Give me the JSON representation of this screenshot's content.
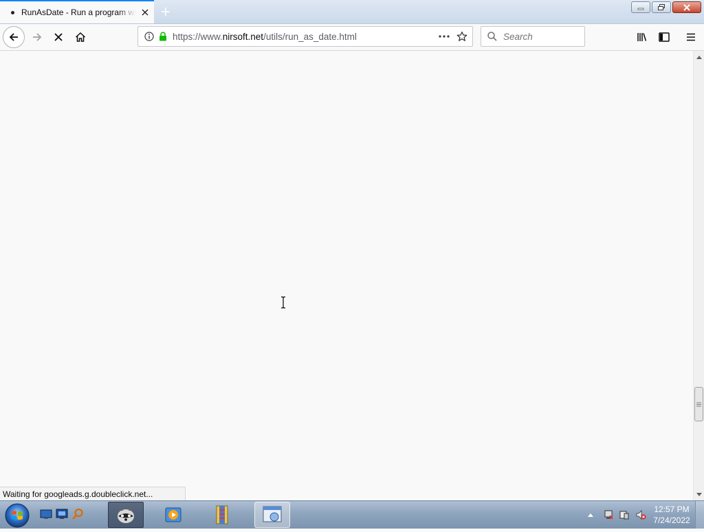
{
  "browser": {
    "tab": {
      "title": "RunAsDate - Run a program with the date/time that you specify"
    },
    "url": {
      "prefix": "https://www.",
      "domain": "nirsoft.net",
      "path": "/utils/run_as_date.html"
    },
    "search": {
      "placeholder": "Search"
    },
    "status": "Waiting for googleads.g.doubleclick.net...",
    "accent": "#0a84ff"
  },
  "taskbar": {
    "clock": {
      "time": "12:57 PM",
      "date": "7/24/2022"
    }
  },
  "icons": {
    "tab": [
      "loading-dot-icon",
      "tab-close-icon",
      "new-tab-icon"
    ],
    "window": [
      "minimize-icon",
      "restore-icon",
      "window-close-icon"
    ],
    "nav": [
      "back-arrow-icon",
      "forward-arrow-icon",
      "stop-loading-icon",
      "home-icon",
      "info-icon",
      "lock-icon",
      "page-actions-icon",
      "bookmark-star-icon",
      "search-icon",
      "library-icon",
      "sidebar-icon",
      "menu-icon"
    ],
    "taskbar": [
      "windows-start-icon",
      "show-desktop-icon",
      "remote-desktop-icon",
      "search-tool-icon",
      "raccoon-app-icon",
      "media-player-icon",
      "file-archive-icon",
      "browser-window-icon",
      "tray-arrow-icon",
      "network-icon",
      "action-center-icon",
      "volume-muted-icon"
    ]
  }
}
